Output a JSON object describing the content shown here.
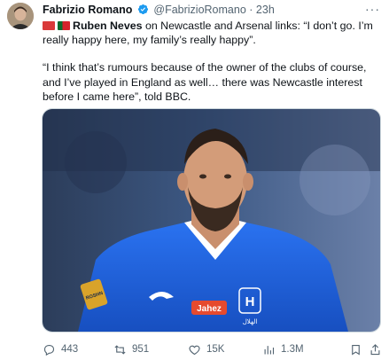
{
  "tweet": {
    "author_name": "Fabrizio Romano",
    "handle": "@FabrizioRomano",
    "separator": "·",
    "time": "23h",
    "more_label": "···",
    "player_name": "Ruben Neves",
    "text_line1_rest": " on Newcastle and Arsenal links: “I don’t go. I’m really happy here, my family’s really happy”.",
    "text_para2": "“I think that’s rumours because of the owner of the clubs of course, and I’ve played in England as well… there was Newcastle interest before I came here”, told BBC.",
    "media": {
      "shirt_sponsor": "Jahez",
      "crest_letter": "H",
      "crest_text": "الهلال",
      "sleeve_badge": "ROSHN"
    },
    "actions": {
      "replies": "443",
      "reposts": "951",
      "likes": "15K",
      "views": "1.3M"
    },
    "colors": {
      "verified": "#1d9bf0",
      "secondary_text": "#536471",
      "kit_blue": "#1b5fd8"
    }
  }
}
